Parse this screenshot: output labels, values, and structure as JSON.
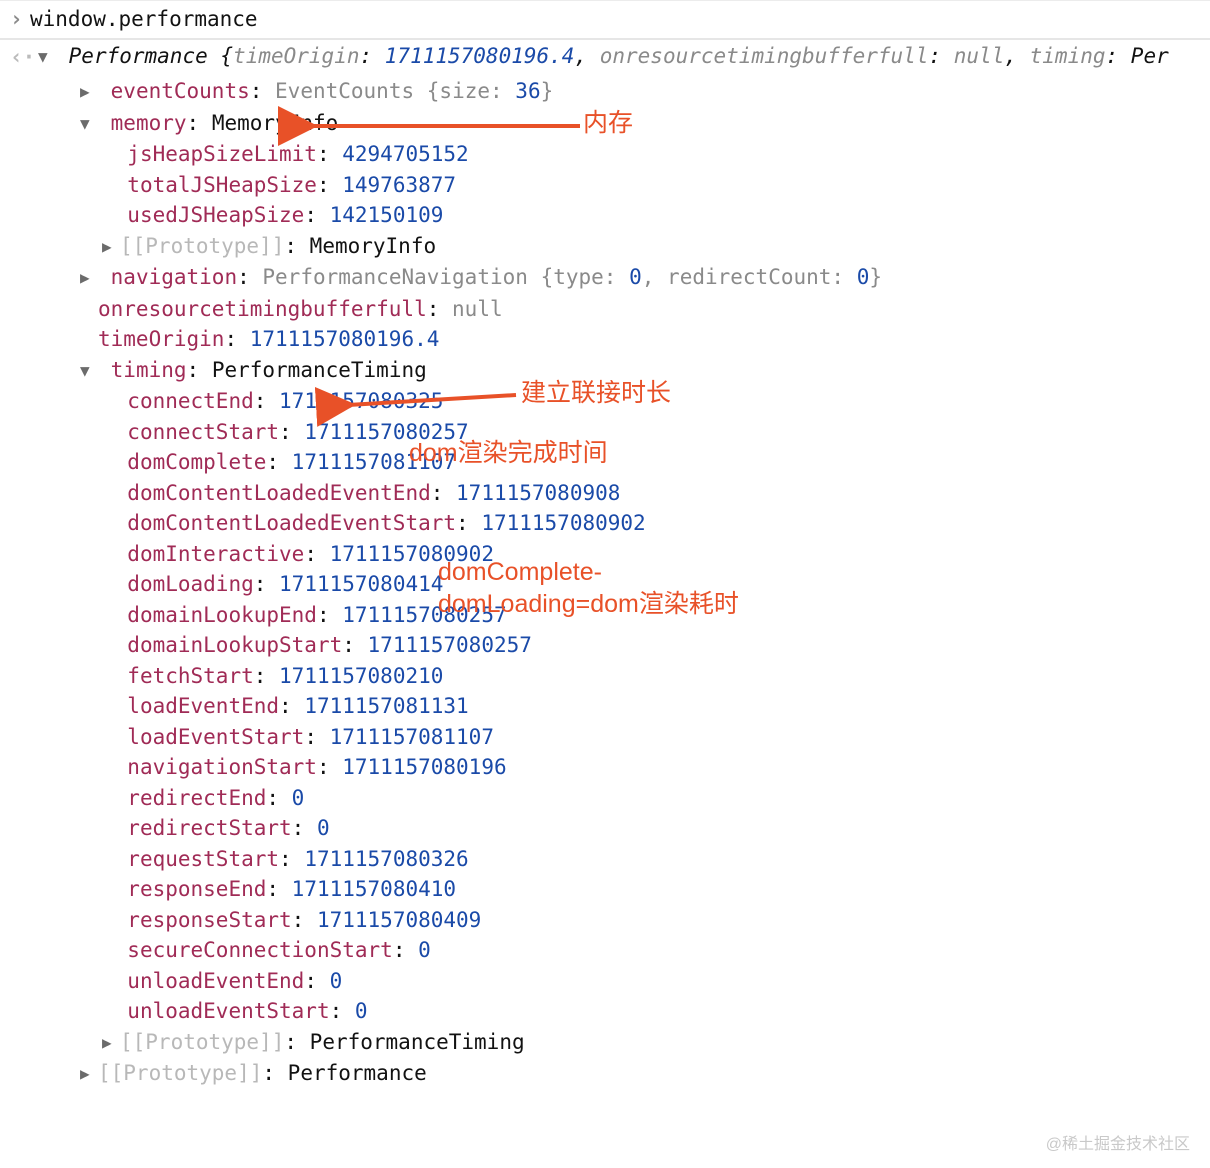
{
  "input": {
    "command": "window.performance"
  },
  "result": {
    "className": "Performance",
    "summary": {
      "timeOrigin": "1711157080196.4",
      "onresourcetimingbufferfull": "null",
      "timingTrunc": "Per"
    },
    "eventCounts": {
      "key": "eventCounts",
      "type": "EventCounts",
      "sizeLabel": "size",
      "sizeValue": "36"
    },
    "memory": {
      "key": "memory",
      "type": "MemoryInfo",
      "jsHeapSizeLimit": "4294705152",
      "totalJSHeapSize": "149763877",
      "usedJSHeapSize": "142150109",
      "protoLabel": "[[Prototype]]",
      "protoType": "MemoryInfo"
    },
    "navigation": {
      "key": "navigation",
      "type": "PerformanceNavigation",
      "typeLabel": "type",
      "typeVal": "0",
      "redirectLabel": "redirectCount",
      "redirectVal": "0"
    },
    "onresourcetimingbufferfull": {
      "key": "onresourcetimingbufferfull",
      "val": "null"
    },
    "timeOrigin": {
      "key": "timeOrigin",
      "val": "1711157080196.4"
    },
    "timing": {
      "key": "timing",
      "type": "PerformanceTiming",
      "connectEnd": "1711157080325",
      "connectStart": "1711157080257",
      "domComplete": "1711157081107",
      "domContentLoadedEventEnd": "1711157080908",
      "domContentLoadedEventStart": "1711157080902",
      "domInteractive": "1711157080902",
      "domLoading": "1711157080414",
      "domainLookupEnd": "1711157080257",
      "domainLookupStart": "1711157080257",
      "fetchStart": "1711157080210",
      "loadEventEnd": "1711157081131",
      "loadEventStart": "1711157081107",
      "navigationStart": "1711157080196",
      "redirectEnd": "0",
      "redirectStart": "0",
      "requestStart": "1711157080326",
      "responseEnd": "1711157080410",
      "responseStart": "1711157080409",
      "secureConnectionStart": "0",
      "unloadEventEnd": "0",
      "unloadEventStart": "0",
      "protoLabel": "[[Prototype]]",
      "protoType": "PerformanceTiming"
    },
    "proto": {
      "label": "[[Prototype]]",
      "type": "Performance"
    }
  },
  "annotations": {
    "memory": "内存",
    "connect": "建立联接时长",
    "domComplete": "dom渲染完成时间",
    "domCalc1": "domComplete-",
    "domCalc2": "domLoading=dom渲染耗时"
  },
  "watermark": "@稀土掘金技术社区"
}
